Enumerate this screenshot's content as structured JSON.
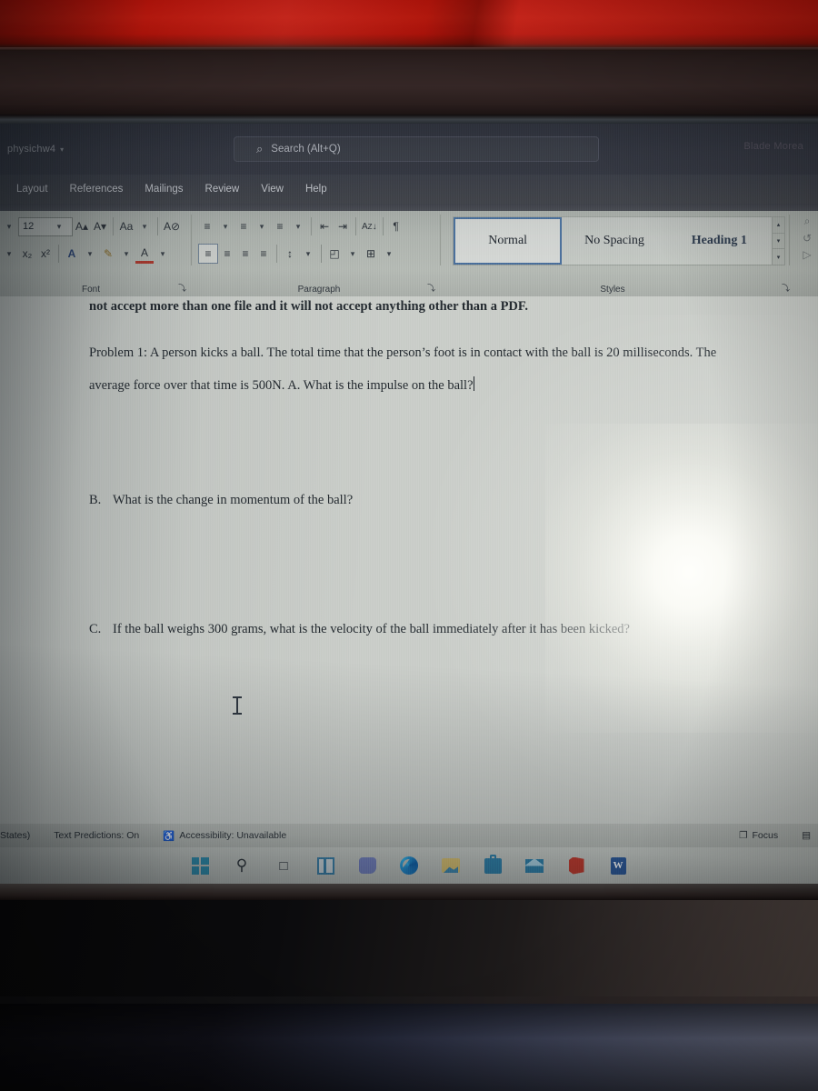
{
  "titlebar": {
    "doc_name": "physichw4",
    "doc_caret": "▾",
    "search_icon": "⌕",
    "search_placeholder": "Search (Alt+Q)",
    "account_name": "Blade Morea"
  },
  "ribbon_tabs": [
    {
      "label": "Layout"
    },
    {
      "label": "References"
    },
    {
      "label": "Mailings"
    },
    {
      "label": "Review"
    },
    {
      "label": "View"
    },
    {
      "label": "Help"
    }
  ],
  "font_group": {
    "label": "Font",
    "font_family_caret": "▾",
    "font_size_value": "12",
    "font_size_caret": "▾",
    "grow_font": "A▴",
    "shrink_font": "A▾",
    "change_case": "Aa",
    "change_case_caret": "▾",
    "clear_formatting": "A⊘",
    "subscript": "x₂",
    "superscript": "x²",
    "text_effects": "A",
    "text_effects_caret": "▾",
    "highlight": "✎",
    "highlight_caret": "▾",
    "font_color": "A",
    "font_color_caret": "▾",
    "dialog_launcher": "⤵"
  },
  "paragraph_group": {
    "label": "Paragraph",
    "bullets": "≡",
    "bullets_caret": "▾",
    "numbering": "≡",
    "numbering_caret": "▾",
    "multilevel": "≡",
    "multilevel_caret": "▾",
    "decrease_indent": "⇤",
    "increase_indent": "⇥",
    "sort": "↓",
    "sort_label": "A\nZ",
    "show_marks": "¶",
    "align_left": "≡",
    "align_center": "≡",
    "align_right": "≡",
    "justify": "≡",
    "line_spacing": "↕",
    "line_spacing_caret": "▾",
    "shading": "◰",
    "shading_caret": "▾",
    "borders": "⊞",
    "borders_caret": "▾",
    "dialog_launcher": "⤵"
  },
  "styles_group": {
    "label": "Styles",
    "items": [
      {
        "name": "Normal",
        "selected": true
      },
      {
        "name": "No Spacing",
        "selected": false
      },
      {
        "name": "Heading 1",
        "selected": false
      }
    ],
    "scroll_up": "▴",
    "scroll_down": "▾",
    "more": "▾",
    "dialog_launcher": "⤵"
  },
  "editing_group": {
    "find": "⌕",
    "replace": "↺",
    "select": "▷"
  },
  "document": {
    "intro_line": "not accept more than one file and it will not accept anything other than a PDF.",
    "problem_paragraph": "Problem 1: A person kicks a ball. The total time that the person’s foot is in contact with the ball is 20 milliseconds. The average force over that time is 500N. A. What is the impulse on the ball?",
    "questions": [
      {
        "label": "B.",
        "text": "What is the change in momentum of the ball?"
      },
      {
        "label": "C.",
        "text": "If the ball weighs 300 grams, what is the velocity of the ball immediately after it has been kicked?"
      }
    ]
  },
  "statusbar": {
    "language": "States)",
    "text_predictions": "Text Predictions: On",
    "accessibility_icon": "♿",
    "accessibility": "Accessibility: Unavailable",
    "focus_icon": "❐",
    "focus": "Focus",
    "read_mode_icon": "▤"
  },
  "taskbar": {
    "items": [
      {
        "name": "start-button",
        "glyph": "windows"
      },
      {
        "name": "search",
        "glyph": "⌕"
      },
      {
        "name": "task-view",
        "glyph": "┗"
      },
      {
        "name": "widgets",
        "glyph": "panel"
      },
      {
        "name": "chat",
        "glyph": "teams"
      },
      {
        "name": "edge",
        "glyph": "edge"
      },
      {
        "name": "photos",
        "glyph": "image"
      },
      {
        "name": "store",
        "glyph": "bag"
      },
      {
        "name": "mail",
        "glyph": "envelope"
      },
      {
        "name": "office",
        "glyph": "office"
      },
      {
        "name": "word",
        "glyph": "W"
      }
    ]
  },
  "colors": {
    "wall": "#c8160c",
    "ribbon": "#b2b7b1",
    "page": "#c9cdc8",
    "titlebar": "#32343d",
    "accent_select": "#4a6f9c",
    "text": "#242a30"
  }
}
